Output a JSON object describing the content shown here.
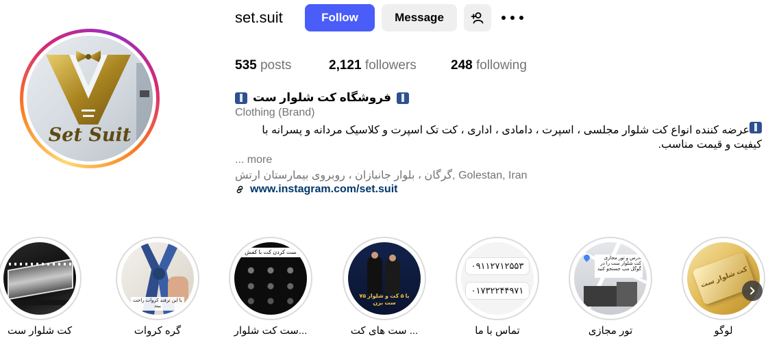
{
  "profile": {
    "username": "set.suit",
    "avatar_text": "Set Suit",
    "follow_label": "Follow",
    "message_label": "Message",
    "add_user_icon": "add-person-icon",
    "more_icon": "more-options-icon"
  },
  "stats": {
    "posts_count": "535",
    "posts_label": "posts",
    "followers_count": "2,121",
    "followers_label": "followers",
    "following_count": "248",
    "following_label": "following"
  },
  "bio": {
    "name": "فروشگاه کت شلوار ست",
    "category": "Clothing (Brand)",
    "description": "عرضه کننده انواع کت شلوار مجلسی ، اسپرت ، دامادی ، اداری ، کت تک اسپرت و کلاسیک مردانه و پسرانه با کیفیت و قیمت مناسب.",
    "more_label": "... more",
    "location": "گرگان ، بلوار جانبازان ، روبروی بیمارستان ارتش, Golestan, Iran",
    "link": "www.instagram.com/set.suit"
  },
  "highlights": [
    {
      "label": "کت شلوار ست"
    },
    {
      "label": "گره کروات"
    },
    {
      "label": "ست کت شلوار..."
    },
    {
      "label": "ست های کت ..."
    },
    {
      "label": "تماس با ما"
    },
    {
      "label": "تور مجازی"
    },
    {
      "label": "لوگو"
    }
  ],
  "highlight_images": {
    "h2_text": "با این ترفند کروات راحت ببند",
    "h3_text": "ست کردن کت با کفش",
    "h4_text": "با ۵ کت و شلوار ۷۵ ست بزن",
    "h5_phone1": "۰۹۱۱۲۷۱۲۵۵۳",
    "h5_phone2": "۰۱۷۳۲۲۴۴۹۷۱",
    "h6_text": "آدرس و تور مجازی کت شلوار ست را در گوگل مپ جستجو کنید",
    "h7_text": "کت شلوار ست"
  },
  "colors": {
    "follow_button": "#4a5df9",
    "secondary_button": "#efefef",
    "muted_text": "#737373",
    "link_text": "#00376b",
    "logo_gold": "#b8962a"
  }
}
